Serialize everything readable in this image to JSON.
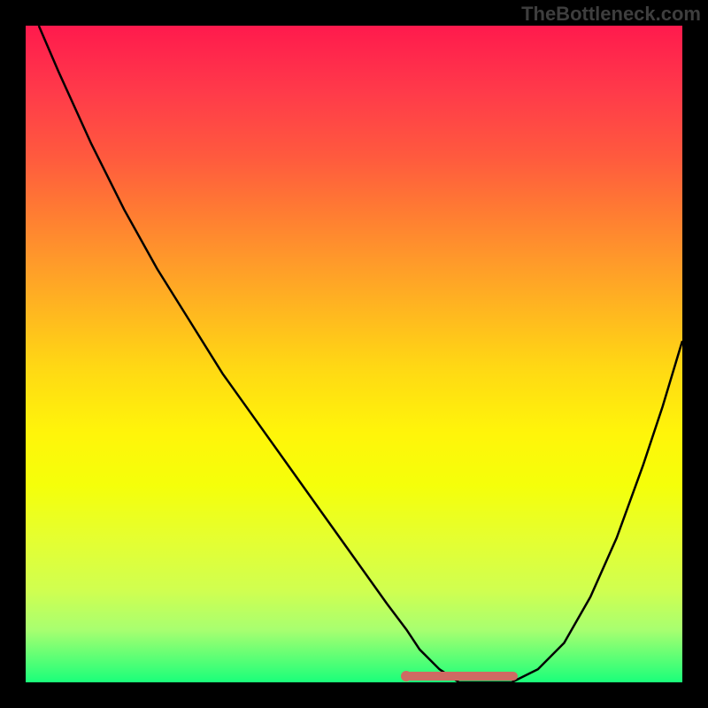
{
  "watermark": "TheBottleneck.com",
  "chart_data": {
    "type": "line",
    "title": "",
    "xlabel": "",
    "ylabel": "",
    "xlim": [
      0,
      100
    ],
    "ylim": [
      0,
      100
    ],
    "grid": false,
    "series": [
      {
        "name": "curve",
        "x": [
          2,
          5,
          10,
          15,
          20,
          25,
          30,
          35,
          40,
          45,
          50,
          55,
          58,
          60,
          63,
          66,
          70,
          74,
          78,
          82,
          86,
          90,
          94,
          97,
          100
        ],
        "values": [
          100,
          93,
          82,
          72,
          63,
          55,
          47,
          40,
          33,
          26,
          19,
          12,
          8,
          5,
          2,
          0,
          0,
          0,
          2,
          6,
          13,
          22,
          33,
          42,
          52
        ]
      }
    ],
    "highlight": {
      "name": "optimal-range",
      "x_start": 58,
      "x_end": 75,
      "y": 1
    },
    "colors": {
      "curve": "#000000",
      "highlight": "#cf6a63",
      "gradient_top": "#ff1a4d",
      "gradient_bottom": "#1aff7a"
    }
  }
}
